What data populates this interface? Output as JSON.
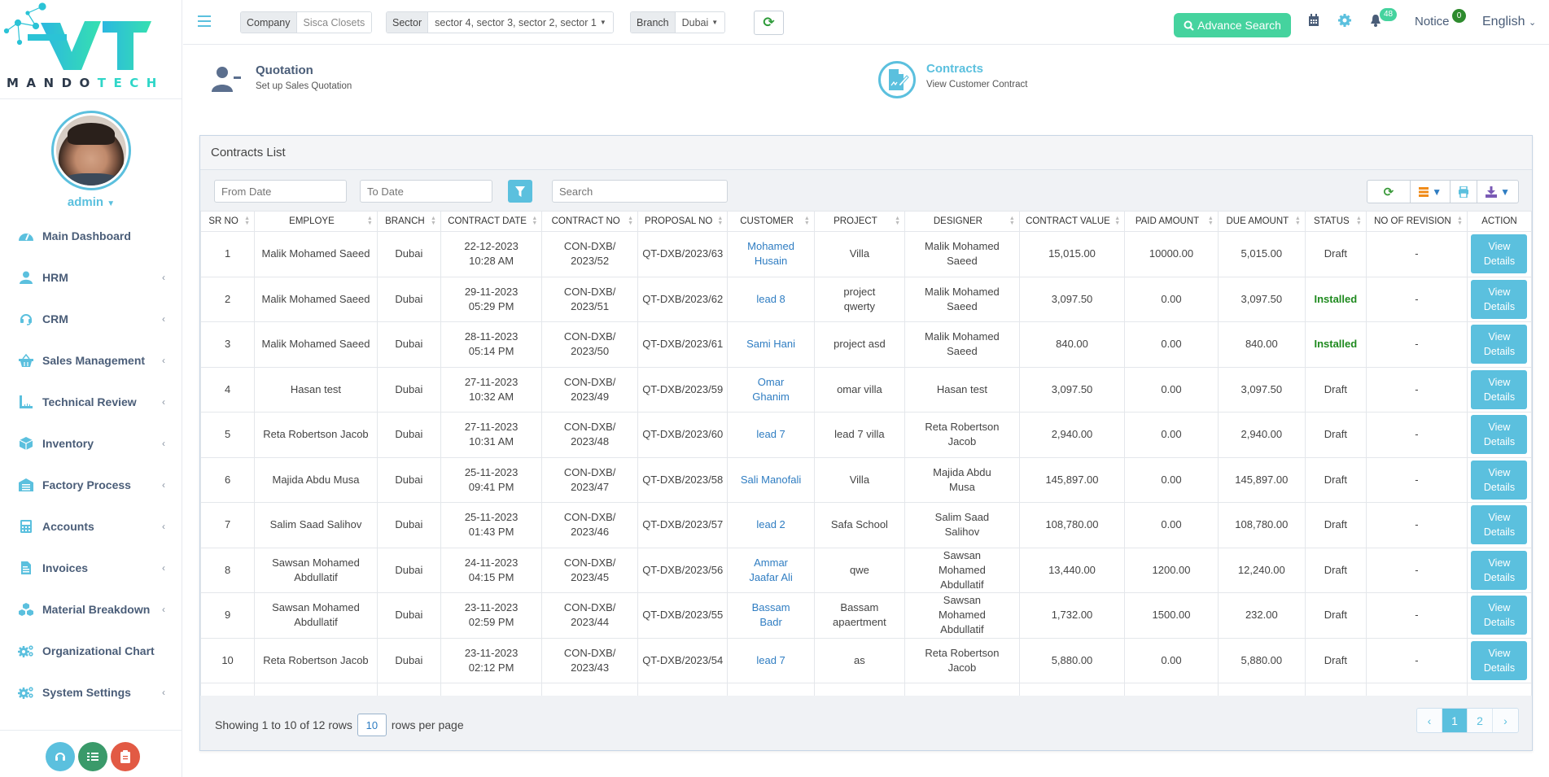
{
  "brand": {
    "name_part1": "MANDO",
    "name_part2": "TECH"
  },
  "user": {
    "name": "admin"
  },
  "sidebar": {
    "items": [
      {
        "label": "Main Dashboard",
        "icon": "dashboard-icon",
        "has_arrow": false
      },
      {
        "label": "HRM",
        "icon": "user-icon",
        "has_arrow": true
      },
      {
        "label": "CRM",
        "icon": "headset-icon",
        "has_arrow": true
      },
      {
        "label": "Sales Management",
        "icon": "basket-icon",
        "has_arrow": true
      },
      {
        "label": "Technical Review",
        "icon": "ruler-icon",
        "has_arrow": true
      },
      {
        "label": "Inventory",
        "icon": "cube-icon",
        "has_arrow": true
      },
      {
        "label": "Factory Process",
        "icon": "warehouse-icon",
        "has_arrow": true
      },
      {
        "label": "Accounts",
        "icon": "calculator-icon",
        "has_arrow": true
      },
      {
        "label": "Invoices",
        "icon": "file-icon",
        "has_arrow": true
      },
      {
        "label": "Material Breakdown",
        "icon": "cubes-icon",
        "has_arrow": true
      },
      {
        "label": "Organizational Chart",
        "icon": "cogs-icon",
        "has_arrow": false
      },
      {
        "label": "System Settings",
        "icon": "cogs-icon",
        "has_arrow": true
      }
    ],
    "arrow": "‹"
  },
  "topbar": {
    "company_label": "Company",
    "company_value": "Sisca Closets",
    "sector_label": "Sector",
    "sector_value": "sector 4, sector 3, sector 2, sector 1",
    "branch_label": "Branch",
    "branch_value": "Dubai",
    "advance_search": "Advance Search",
    "notifications_count": "48",
    "notice_label": "Notice",
    "notice_count": "0",
    "language": "English"
  },
  "cards": {
    "quotation": {
      "title": "Quotation",
      "subtitle": "Set up Sales Quotation"
    },
    "contracts": {
      "title": "Contracts",
      "subtitle": "View Customer Contract"
    }
  },
  "panel": {
    "title": "Contracts List",
    "from_date_placeholder": "From Date",
    "to_date_placeholder": "To Date",
    "search_placeholder": "Search"
  },
  "table": {
    "columns": [
      "SR NO",
      "EMPLOYE",
      "BRANCH",
      "CONTRACT DATE",
      "CONTRACT NO",
      "PROPOSAL NO",
      "CUSTOMER",
      "PROJECT",
      "DESIGNER",
      "CONTRACT VALUE",
      "PAID AMOUNT",
      "DUE AMOUNT",
      "STATUS",
      "NO OF REVISION",
      "ACTION"
    ],
    "action_label": "View Details",
    "rows": [
      {
        "sr": "1",
        "employee": "Malik Mohamed Saeed",
        "branch": "Dubai",
        "date": "22-12-2023",
        "time": "10:28 AM",
        "contract_no": "CON-DXB/ 2023/52",
        "proposal_no": "QT-DXB/2023/63",
        "customer": "Mohamed Husain",
        "project": "Villa",
        "designer": "Malik Mohamed Saeed",
        "contract_value": "15,015.00",
        "paid": "10000.00",
        "due": "5,015.00",
        "status": "Draft",
        "revisions": "-"
      },
      {
        "sr": "2",
        "employee": "Malik Mohamed Saeed",
        "branch": "Dubai",
        "date": "29-11-2023",
        "time": "05:29 PM",
        "contract_no": "CON-DXB/ 2023/51",
        "proposal_no": "QT-DXB/2023/62",
        "customer": "lead 8",
        "project": "project qwerty",
        "designer": "Malik Mohamed Saeed",
        "contract_value": "3,097.50",
        "paid": "0.00",
        "due": "3,097.50",
        "status": "Installed",
        "revisions": "-"
      },
      {
        "sr": "3",
        "employee": "Malik Mohamed Saeed",
        "branch": "Dubai",
        "date": "28-11-2023",
        "time": "05:14 PM",
        "contract_no": "CON-DXB/ 2023/50",
        "proposal_no": "QT-DXB/2023/61",
        "customer": "Sami Hani",
        "project": "project asd",
        "designer": "Malik Mohamed Saeed",
        "contract_value": "840.00",
        "paid": "0.00",
        "due": "840.00",
        "status": "Installed",
        "revisions": "-"
      },
      {
        "sr": "4",
        "employee": "Hasan test",
        "branch": "Dubai",
        "date": "27-11-2023",
        "time": "10:32 AM",
        "contract_no": "CON-DXB/ 2023/49",
        "proposal_no": "QT-DXB/2023/59",
        "customer": "Omar Ghanim",
        "project": "omar villa",
        "designer": "Hasan test",
        "contract_value": "3,097.50",
        "paid": "0.00",
        "due": "3,097.50",
        "status": "Draft",
        "revisions": "-"
      },
      {
        "sr": "5",
        "employee": "Reta Robertson Jacob",
        "branch": "Dubai",
        "date": "27-11-2023",
        "time": "10:31 AM",
        "contract_no": "CON-DXB/ 2023/48",
        "proposal_no": "QT-DXB/2023/60",
        "customer": "lead 7",
        "project": "lead 7 villa",
        "designer": "Reta Robertson Jacob",
        "contract_value": "2,940.00",
        "paid": "0.00",
        "due": "2,940.00",
        "status": "Draft",
        "revisions": "-"
      },
      {
        "sr": "6",
        "employee": "Majida Abdu Musa",
        "branch": "Dubai",
        "date": "25-11-2023",
        "time": "09:41 PM",
        "contract_no": "CON-DXB/ 2023/47",
        "proposal_no": "QT-DXB/2023/58",
        "customer": "Sali Manofali",
        "project": "Villa",
        "designer": "Majida Abdu Musa",
        "contract_value": "145,897.00",
        "paid": "0.00",
        "due": "145,897.00",
        "status": "Draft",
        "revisions": "-"
      },
      {
        "sr": "7",
        "employee": "Salim Saad Salihov",
        "branch": "Dubai",
        "date": "25-11-2023",
        "time": "01:43 PM",
        "contract_no": "CON-DXB/ 2023/46",
        "proposal_no": "QT-DXB/2023/57",
        "customer": "lead 2",
        "project": "Safa School",
        "designer": "Salim Saad Salihov",
        "contract_value": "108,780.00",
        "paid": "0.00",
        "due": "108,780.00",
        "status": "Draft",
        "revisions": "-"
      },
      {
        "sr": "8",
        "employee": "Sawsan Mohamed Abdullatif",
        "branch": "Dubai",
        "date": "24-11-2023",
        "time": "04:15 PM",
        "contract_no": "CON-DXB/ 2023/45",
        "proposal_no": "QT-DXB/2023/56",
        "customer": "Ammar Jaafar Ali",
        "project": "qwe",
        "designer": "Sawsan Mohamed Abdullatif",
        "contract_value": "13,440.00",
        "paid": "1200.00",
        "due": "12,240.00",
        "status": "Draft",
        "revisions": "-"
      },
      {
        "sr": "9",
        "employee": "Sawsan Mohamed Abdullatif",
        "branch": "Dubai",
        "date": "23-11-2023",
        "time": "02:59 PM",
        "contract_no": "CON-DXB/ 2023/44",
        "proposal_no": "QT-DXB/2023/55",
        "customer": "Bassam Badr",
        "project": "Bassam apaertment",
        "designer": "Sawsan Mohamed Abdullatif",
        "contract_value": "1,732.00",
        "paid": "1500.00",
        "due": "232.00",
        "status": "Draft",
        "revisions": "-"
      },
      {
        "sr": "10",
        "employee": "Reta Robertson Jacob",
        "branch": "Dubai",
        "date": "23-11-2023",
        "time": "02:12 PM",
        "contract_no": "CON-DXB/ 2023/43",
        "proposal_no": "QT-DXB/2023/54",
        "customer": "lead 7",
        "project": "as",
        "designer": "Reta Robertson Jacob",
        "contract_value": "5,880.00",
        "paid": "0.00",
        "due": "5,880.00",
        "status": "Draft",
        "revisions": "-"
      }
    ]
  },
  "pagination": {
    "showing_text": "Showing 1 to 10 of 12 rows",
    "rows_per_page": "10",
    "rows_per_page_label": "rows per page",
    "prev": "‹",
    "pages": [
      "1",
      "2"
    ],
    "active_page": "1",
    "next": "›"
  },
  "colors": {
    "accent": "#5bc0de",
    "success": "#45d39e",
    "installed": "#1f8a1f",
    "link": "#2f7dc2"
  }
}
